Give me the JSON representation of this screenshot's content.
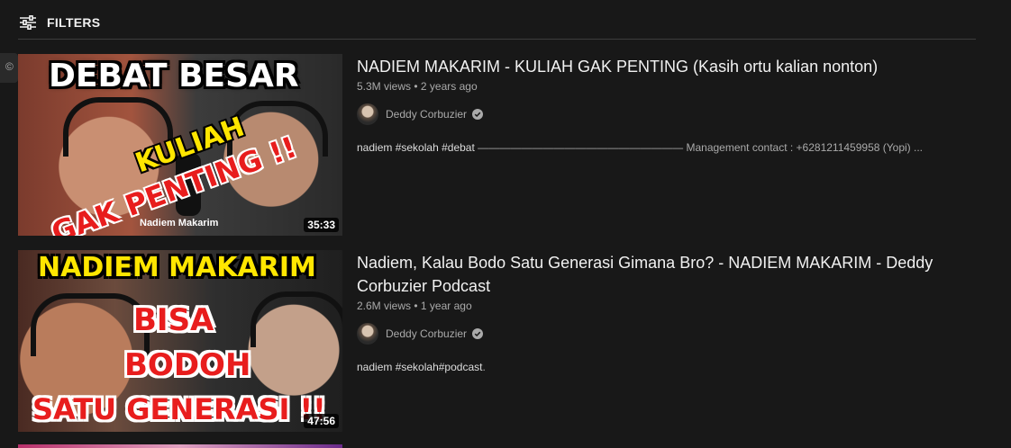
{
  "filters": {
    "label": "FILTERS",
    "icon": "sliders-icon"
  },
  "results": [
    {
      "thumbnail": {
        "headline": "DEBAT BESAR",
        "line_a": "KULIAH",
        "line_b": "GAK PENTING !!",
        "name_tag": "Nadiem Makarim",
        "duration": "35:33"
      },
      "title": "NADIEM MAKARIM - KULIAH GAK PENTING (Kasih ortu kalian nonton)",
      "views": "5.3M views",
      "age": "2 years ago",
      "channel": "Deddy Corbuzier",
      "desc_tags": [
        "nadiem",
        "#sekolah",
        "#debat"
      ],
      "desc_rest": " ——————————————————— Management contact : +6281211459958 (Yopi) ..."
    },
    {
      "thumbnail": {
        "headline": "NADIEM MAKARIM",
        "line_a": "BISA",
        "line_b": "BODOH",
        "line_c": "SATU GENERASI !!",
        "duration": "47:56"
      },
      "title": "Nadiem, Kalau Bodo Satu Generasi Gimana Bro? - NADIEM MAKARIM - Deddy Corbuzier Podcast",
      "views": "2.6M views",
      "age": "1 year ago",
      "channel": "Deddy Corbuzier",
      "desc_tags": [
        "nadiem",
        "#sekolah",
        "#podcast"
      ],
      "desc_rest": "."
    }
  ],
  "colors": {
    "background": "#181818",
    "text": "#f1f1f1",
    "secondary": "#aaaaaa"
  },
  "stats_separator": "•"
}
